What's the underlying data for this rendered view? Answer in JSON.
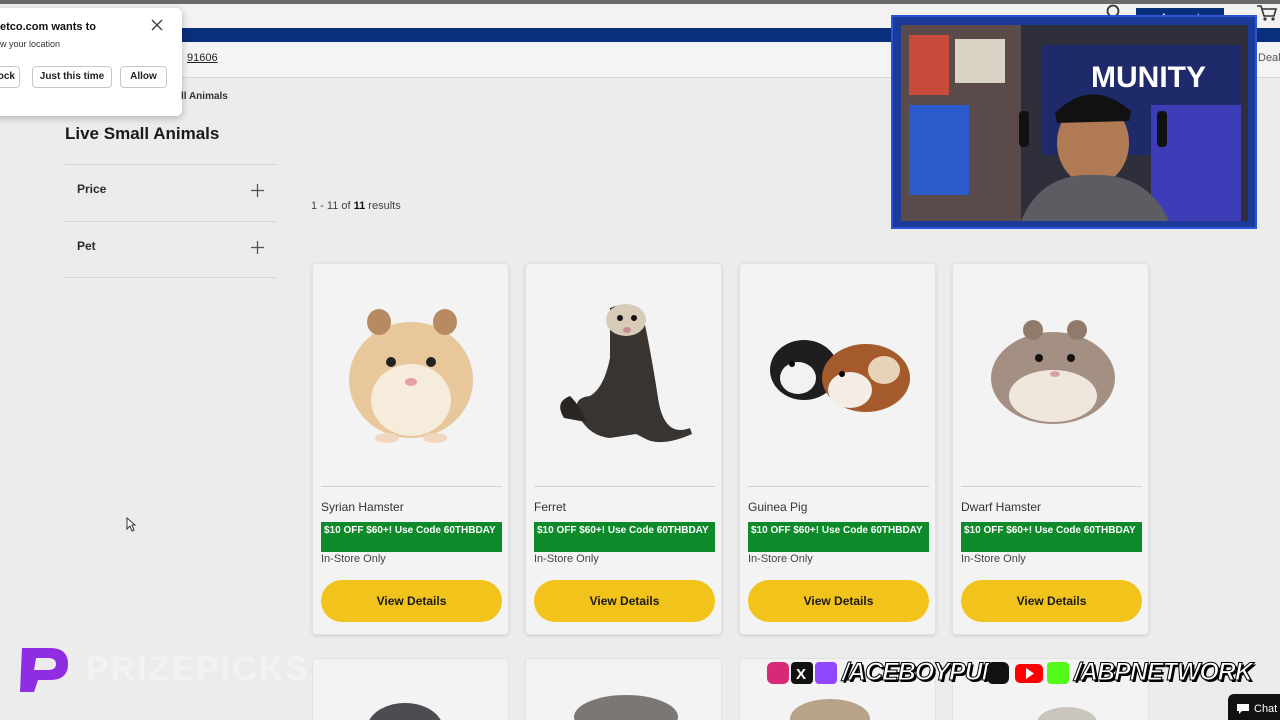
{
  "popup": {
    "title": "etco.com wants to",
    "subtitle": "w your location",
    "buttons": {
      "block": "ock",
      "once": "Just this time",
      "allow": "Allow"
    }
  },
  "header": {
    "account_label": "Account",
    "zip": "91606",
    "deals_label": "Deal"
  },
  "breadcrumb": "ll Animals",
  "page_title": "Live Small Animals",
  "filters": [
    {
      "label": "Price"
    },
    {
      "label": "Pet"
    }
  ],
  "results": {
    "range": "1 - 11 of ",
    "count": "11",
    "suffix": " results"
  },
  "products": [
    {
      "name": "Syrian Hamster",
      "promo": "$10 OFF $60+! Use Code 60THBDAY",
      "availability": "In-Store Only",
      "button": "View Details"
    },
    {
      "name": "Ferret",
      "promo": "$10 OFF $60+! Use Code 60THBDAY",
      "availability": "In-Store Only",
      "button": "View Details"
    },
    {
      "name": "Guinea Pig",
      "promo": "$10 OFF $60+! Use Code 60THBDAY",
      "availability": "In-Store Only",
      "button": "View Details"
    },
    {
      "name": "Dwarf Hamster",
      "promo": "$10 OFF $60+! Use Code 60THBDAY",
      "availability": "In-Store Only",
      "button": "View Details"
    }
  ],
  "overlay": {
    "webcam_banner": "MUNITY",
    "sponsor": "PRIZEPICKS",
    "handle_1": "/ACEBOYPUN",
    "handle_2": "/ABPNETWORK",
    "chat_label": "Chat"
  },
  "colors": {
    "brand_blue": "#0a2f7a",
    "promo_green": "#0f8a2a",
    "button_yellow": "#f2c31a",
    "sponsor_purple": "#8e2de2"
  }
}
